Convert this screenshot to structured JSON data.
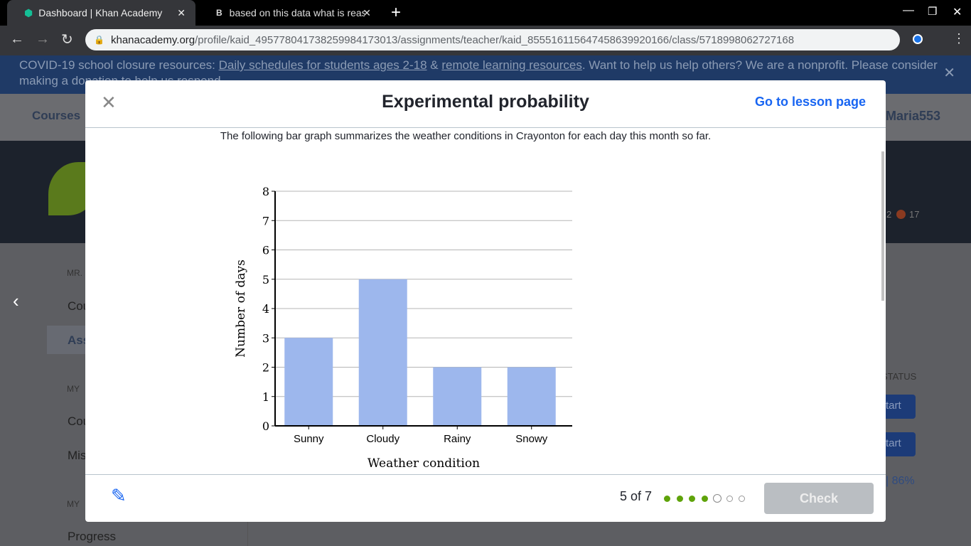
{
  "browser": {
    "tabs": [
      {
        "title": "Dashboard | Khan Academy",
        "active": true
      },
      {
        "title": "based on this data what is reaso",
        "active": false
      }
    ],
    "url_domain": "khanacademy.org",
    "url_path": "/profile/kaid_495778041738259984173013/assignments/teacher/kaid_855516115647458639920166/class/5718998062727168"
  },
  "banner": {
    "prefix": "COVID-19 school closure resources: ",
    "link1": "Daily schedules for students ages 2-18",
    "amp": " & ",
    "link2": "remote learning resources",
    "suffix": ". Want to help us help others? We are a nonprofit. Please consider making a donation to help us respond."
  },
  "background": {
    "courses": "Courses",
    "username": "Maria553",
    "points": "2",
    "streak": "17",
    "sidebar": [
      "MR.",
      "Cou",
      "Ass",
      "MY",
      "Cou",
      "Mis",
      "MY",
      "Progress"
    ],
    "status_header": "STATUS",
    "start1": "tart",
    "start2": "tart",
    "score": "| 86%"
  },
  "modal": {
    "title": "Experimental probability",
    "lesson_link": "Go to lesson page",
    "prompt": "The following bar graph summarizes the weather conditions in Crayonton for each day this month so far.",
    "progress": "5 of 7",
    "completed": 4,
    "current": 5,
    "total": 7,
    "check": "Check"
  },
  "colors": {
    "bar": "#9db7ed",
    "accent": "#1865f2",
    "progress_done": "#5fa30a"
  },
  "chart_data": {
    "type": "bar",
    "categories": [
      "Sunny",
      "Cloudy",
      "Rainy",
      "Snowy"
    ],
    "values": [
      3,
      5,
      2,
      2
    ],
    "xlabel": "Weather condition",
    "ylabel": "Number of days",
    "ylim": [
      0,
      8
    ],
    "yticks": [
      "0",
      "1",
      "2",
      "3",
      "4",
      "5",
      "6",
      "7",
      "8"
    ],
    "grid": true
  }
}
